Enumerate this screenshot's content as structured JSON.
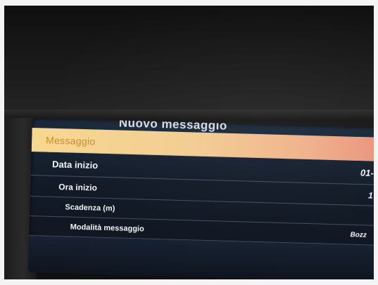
{
  "screen": {
    "title": "Nuovo messaggio",
    "menu_items": [
      {
        "label": "Messaggio",
        "value": "",
        "selected": true
      },
      {
        "label": "Data inizio",
        "value": "01-",
        "selected": false
      },
      {
        "label": "Ora inizio",
        "value": "1",
        "selected": false
      },
      {
        "label": "Scadenza (m)",
        "value": "",
        "selected": false
      },
      {
        "label": "Modalità messaggio",
        "value": "Bozz",
        "selected": false
      }
    ]
  },
  "colors": {
    "highlight": "#f3cc92",
    "screen_background": "#131b28",
    "bezel": "#1a1a1a"
  }
}
